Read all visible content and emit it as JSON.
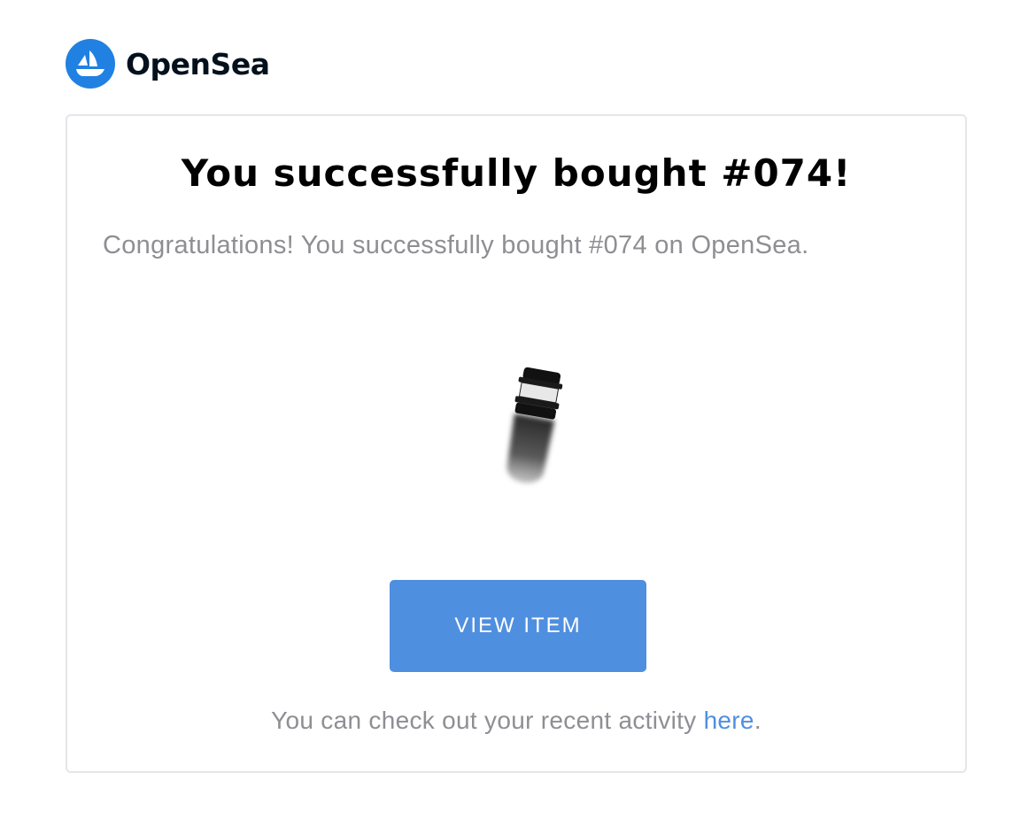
{
  "brand": {
    "name": "OpenSea",
    "logo_icon": "opensea-ship-icon",
    "logo_color": "#2081e2"
  },
  "card": {
    "title": "You successfully bought #074!",
    "subtitle": "Congratulations! You successfully bought #074 on OpenSea.",
    "image_icon": "nft-item-image",
    "button_label": "VIEW ITEM",
    "footer_text": "You can check out your recent activity ",
    "footer_link": "here",
    "footer_end": "."
  },
  "colors": {
    "accent": "#4f8fe0",
    "muted_text": "#8e8e93",
    "title_text": "#000000",
    "border": "#e5e5ea"
  }
}
